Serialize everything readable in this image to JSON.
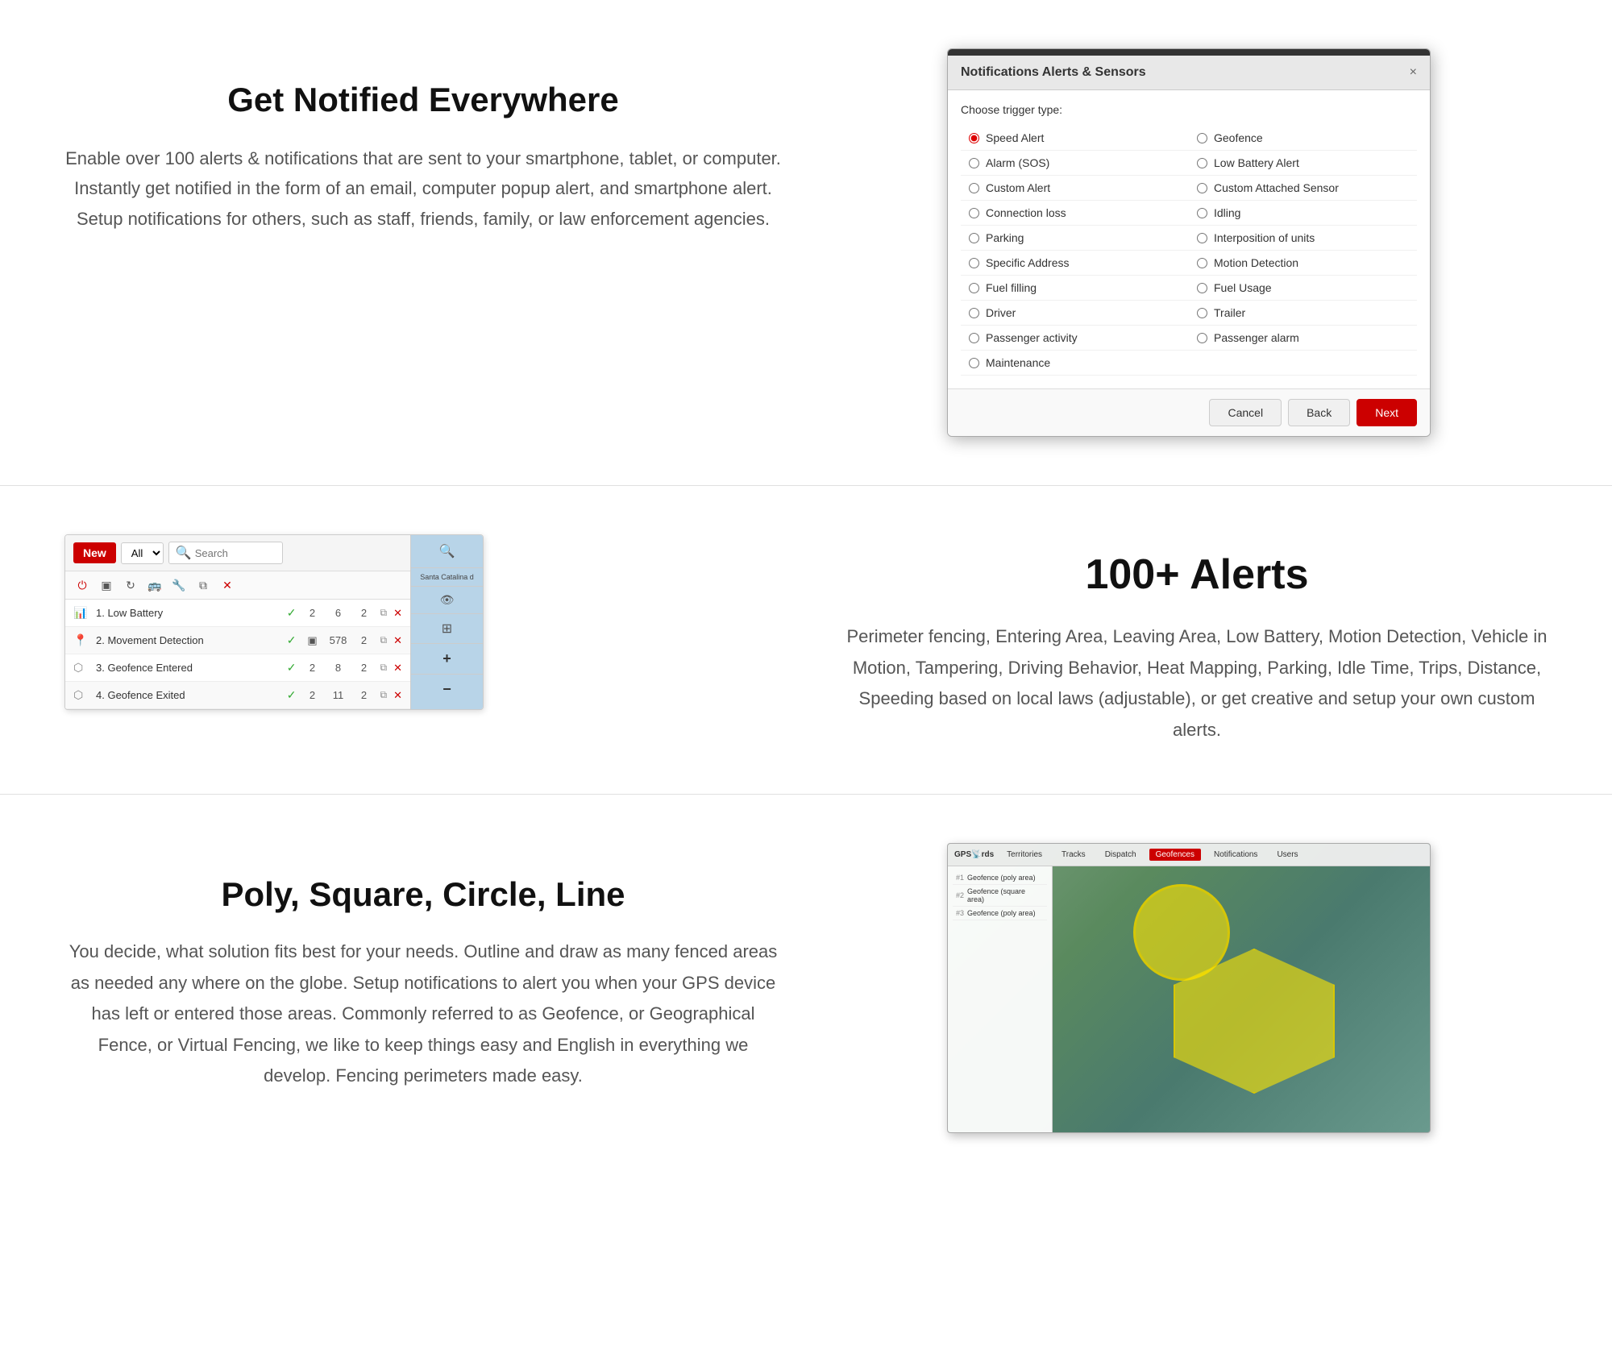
{
  "section1": {
    "title": "Get Notified Everywhere",
    "description": "Enable over 100 alerts & notifications that are sent to your smartphone, tablet, or computer. Instantly get notified in the form of an email, computer popup alert, and smartphone alert. Setup notifications for others, such as staff, friends, family, or law enforcement agencies."
  },
  "modal": {
    "title": "Notifications Alerts & Sensors",
    "trigger_label": "Choose trigger type:",
    "close_btn": "×",
    "options_left": [
      {
        "label": "Speed Alert",
        "checked": true
      },
      {
        "label": "Alarm (SOS)",
        "checked": false
      },
      {
        "label": "Custom Alert",
        "checked": false
      },
      {
        "label": "Connection loss",
        "checked": false
      },
      {
        "label": "Parking",
        "checked": false
      },
      {
        "label": "Specific Address",
        "checked": false
      },
      {
        "label": "Fuel filling",
        "checked": false
      },
      {
        "label": "Driver",
        "checked": false
      },
      {
        "label": "Passenger activity",
        "checked": false
      },
      {
        "label": "Maintenance",
        "checked": false
      }
    ],
    "options_right": [
      {
        "label": "Geofence",
        "checked": false
      },
      {
        "label": "Low Battery Alert",
        "checked": false
      },
      {
        "label": "Custom Attached Sensor",
        "checked": false
      },
      {
        "label": "Idling",
        "checked": false
      },
      {
        "label": "Interposition of units",
        "checked": false
      },
      {
        "label": "Motion Detection",
        "checked": false
      },
      {
        "label": "Fuel Usage",
        "checked": false
      },
      {
        "label": "Trailer",
        "checked": false
      },
      {
        "label": "Passenger alarm",
        "checked": false
      },
      {
        "label": "",
        "checked": false
      }
    ],
    "cancel_btn": "Cancel",
    "back_btn": "Back",
    "next_btn": "Next"
  },
  "section2": {
    "new_btn": "New",
    "all_option": "All",
    "search_placeholder": "Search",
    "alerts": [
      {
        "num": "1.",
        "name": "Low Battery",
        "check": true,
        "val1": "2",
        "val2": "6",
        "val3": "2"
      },
      {
        "num": "2.",
        "name": "Movement Detection",
        "check": true,
        "val1": "",
        "val2": "578",
        "val3": "2"
      },
      {
        "num": "3.",
        "name": "Geofence Entered",
        "check": true,
        "val1": "2",
        "val2": "8",
        "val3": "2"
      },
      {
        "num": "4.",
        "name": "Geofence Exited",
        "check": true,
        "val1": "2",
        "val2": "11",
        "val3": "2"
      }
    ],
    "map_label": "Santa Catalina d",
    "map_zoom_plus": "+",
    "map_zoom_minus": "−",
    "heading": "100+ Alerts",
    "description": "Perimeter fencing, Entering Area, Leaving Area, Low Battery, Motion Detection, Vehicle in Motion, Tampering, Driving Behavior, Heat Mapping, Parking, Idle Time, Trips, Distance, Speeding based on local laws (adjustable), or get creative and setup your own custom alerts."
  },
  "section3": {
    "title": "Poly, Square, Circle, Line",
    "description": "You decide, what solution fits best for your needs. Outline and draw as many fenced areas as needed any where on the globe. Setup notifications to alert you when your GPS device has left or entered those areas. Commonly referred to as Geofence, or Geographical Fence, or Virtual Fencing, we like to keep things easy and English in everything we develop. Fencing perimeters made easy.",
    "map_tabs": [
      "Territories",
      "Tracks",
      "Dispatch",
      "Geofences",
      "Notifications",
      "Users"
    ],
    "map_rows": [
      {
        "num": "1",
        "name": "Geofence (poly area)"
      },
      {
        "num": "2",
        "name": "Geofence (square area)"
      },
      {
        "num": "3",
        "name": "Geofence (poly area)"
      }
    ]
  },
  "icons": {
    "search": "🔍",
    "close": "×",
    "power": "⏻",
    "refresh": "↻",
    "copy": "⧉",
    "delete": "✕",
    "check": "✓",
    "eye": "👁",
    "layers": "⊞",
    "bar_chart": "📊",
    "location": "📍",
    "geofence": "⬡"
  }
}
